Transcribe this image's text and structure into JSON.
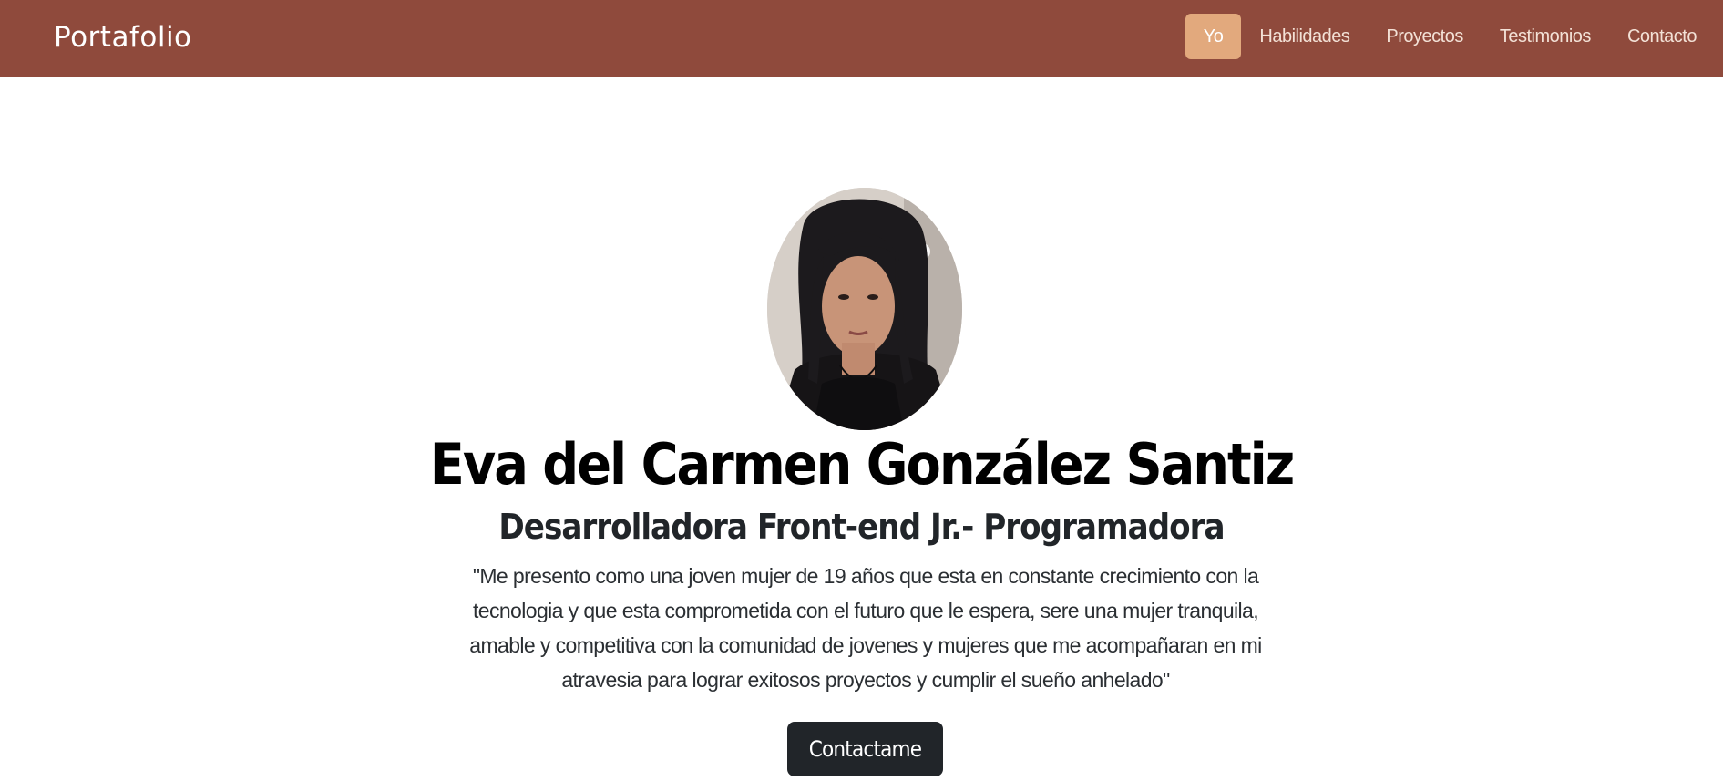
{
  "navbar": {
    "brand": "Portafolio",
    "links": [
      {
        "label": "Yo",
        "active": true
      },
      {
        "label": "Habilidades",
        "active": false
      },
      {
        "label": "Proyectos",
        "active": false
      },
      {
        "label": "Testimonios",
        "active": false
      },
      {
        "label": "Contacto",
        "active": false
      }
    ]
  },
  "hero": {
    "name": "Eva del Carmen González Santiz",
    "role": "Desarrolladora Front-end Jr.- Programadora",
    "about": "\"Me presento como una joven mujer de 19 años que esta en constante crecimiento con la tecnologia y que esta comprometida con el futuro que le espera, sere una mujer tranquila, amable y competitiva con la comunidad de jovenes y mujeres que me acompañaran en mi atravesia para lograr exitosos proyectos y cumplir el sueño anhelado\"",
    "cta_label": "Contactame"
  },
  "colors": {
    "navbar_bg": "#8f4a3c",
    "active_link_bg": "#e2a97d",
    "button_bg": "#212529"
  }
}
